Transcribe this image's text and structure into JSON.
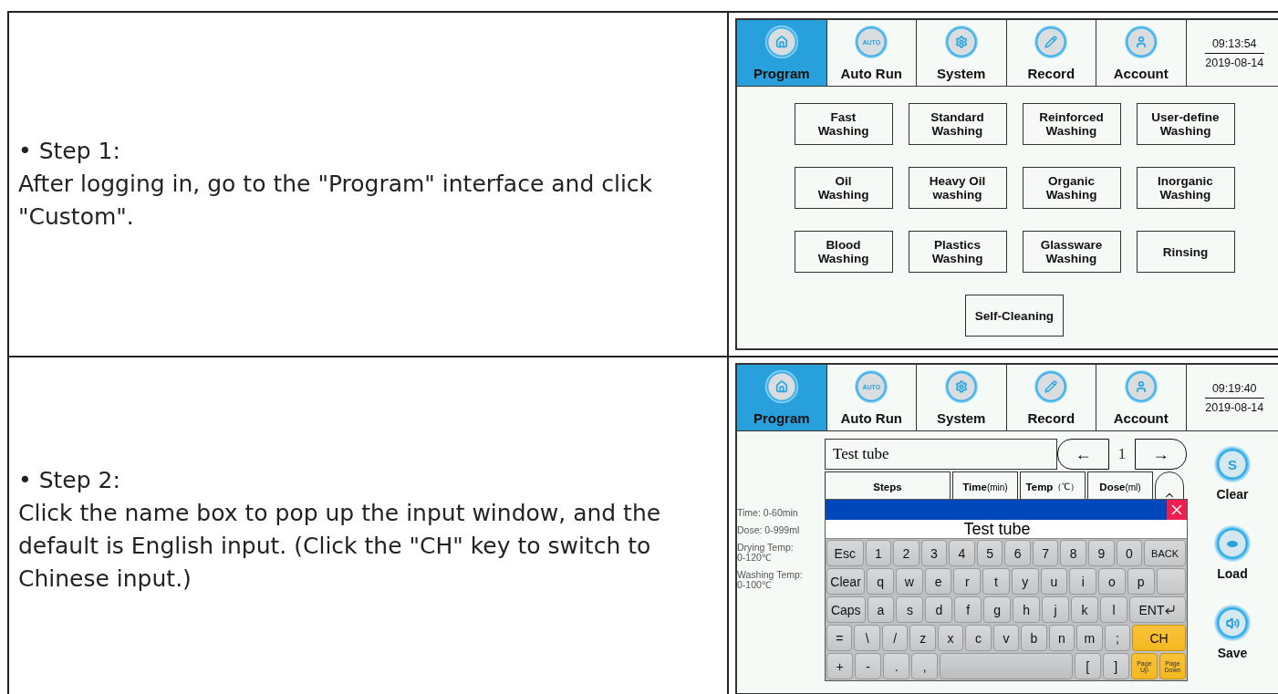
{
  "rows": [
    {
      "step": "• Step 1:",
      "text": "After logging in, go to the \"Program\" interface and click \"Custom\".",
      "screen": {
        "kind": "program",
        "tabs": [
          {
            "label": "Program",
            "kind": "home",
            "selected": true
          },
          {
            "label": "Auto Run",
            "kind": "auto",
            "icon_text": "AUTO",
            "selected": false
          },
          {
            "label": "System",
            "kind": "gear",
            "selected": false
          },
          {
            "label": "Record",
            "kind": "pencil",
            "selected": false
          },
          {
            "label": "Account",
            "kind": "person",
            "selected": false
          }
        ],
        "clock": {
          "time": "09:13:54",
          "date": "2019-08-14"
        },
        "programs": [
          "Fast\nWashing",
          "Standard\nWashing",
          "Reinforced\nWashing",
          "User-define\nWashing",
          "Oil\nWashing",
          "Heavy Oil\nwashing",
          "Organic\nWashing",
          "Inorganic\nWashing",
          "Blood\nWashing",
          "Plastics\nWashing",
          "Glassware\nWashing",
          "Rinsing",
          "Self-Cleaning"
        ]
      }
    },
    {
      "step": "• Step 2:",
      "text": "Click the name box to pop up the input window, and the default is English input. (Click the \"CH\" key to switch to Chinese input.)",
      "screen": {
        "kind": "editor",
        "tabs": [
          {
            "label": "Program",
            "kind": "home",
            "selected": true
          },
          {
            "label": "Auto Run",
            "kind": "auto",
            "icon_text": "AUTO",
            "selected": false
          },
          {
            "label": "System",
            "kind": "gear",
            "selected": false
          },
          {
            "label": "Record",
            "kind": "pencil",
            "selected": false
          },
          {
            "label": "Account",
            "kind": "person",
            "selected": false
          }
        ],
        "clock": {
          "time": "09:19:40",
          "date": "2019-08-14"
        },
        "hints": [
          "Time: 0-60min",
          "Dose: 0-999ml",
          "Drying Temp:\n0-120℃",
          "Washing Temp:\n0-100℃"
        ],
        "name_field": {
          "value": "Test tube"
        },
        "pager": {
          "prev": "←",
          "page": "1",
          "next": "→"
        },
        "columns": [
          {
            "label": "Steps"
          },
          {
            "label": "Time",
            "unit": "(min)"
          },
          {
            "label": "Temp",
            "unit": "（℃）"
          },
          {
            "label": "Dose",
            "unit": "(ml)"
          }
        ],
        "keyboard": {
          "input": "Test tube",
          "rows": [
            [
              {
                "label": "Esc",
                "kind": "wide"
              },
              {
                "label": "1",
                "kind": "key"
              },
              {
                "label": "2",
                "kind": "key"
              },
              {
                "label": "3",
                "kind": "key"
              },
              {
                "label": "4",
                "kind": "key"
              },
              {
                "label": "5",
                "kind": "key"
              },
              {
                "label": "6",
                "kind": "key"
              },
              {
                "label": "7",
                "kind": "key"
              },
              {
                "label": "8",
                "kind": "key"
              },
              {
                "label": "9",
                "kind": "key"
              },
              {
                "label": "0",
                "kind": "key"
              },
              {
                "label": "BACK",
                "kind": "back"
              }
            ],
            [
              {
                "label": "Clear",
                "kind": "wide"
              },
              {
                "label": "q",
                "kind": "key"
              },
              {
                "label": "w",
                "kind": "key"
              },
              {
                "label": "e",
                "kind": "key"
              },
              {
                "label": "r",
                "kind": "key"
              },
              {
                "label": "t",
                "kind": "key"
              },
              {
                "label": "y",
                "kind": "key"
              },
              {
                "label": "u",
                "kind": "key"
              },
              {
                "label": "i",
                "kind": "key"
              },
              {
                "label": "o",
                "kind": "key"
              },
              {
                "label": "p",
                "kind": "key"
              },
              {
                "kind": "enter-top"
              }
            ],
            [
              {
                "label": "Caps",
                "kind": "wide"
              },
              {
                "label": "a",
                "kind": "key"
              },
              {
                "label": "s",
                "kind": "key"
              },
              {
                "label": "d",
                "kind": "key"
              },
              {
                "label": "f",
                "kind": "key"
              },
              {
                "label": "g",
                "kind": "key"
              },
              {
                "label": "h",
                "kind": "key"
              },
              {
                "label": "j",
                "kind": "key"
              },
              {
                "label": "k",
                "kind": "key"
              },
              {
                "label": "l",
                "kind": "key"
              },
              {
                "label": "ENT",
                "kind": "enter"
              }
            ],
            [
              {
                "label": "=",
                "kind": "key"
              },
              {
                "label": "\\",
                "kind": "key"
              },
              {
                "label": "/",
                "kind": "key"
              },
              {
                "label": "z",
                "kind": "key"
              },
              {
                "label": "x",
                "kind": "key"
              },
              {
                "label": "c",
                "kind": "key"
              },
              {
                "label": "v",
                "kind": "key"
              },
              {
                "label": "b",
                "kind": "key"
              },
              {
                "label": "n",
                "kind": "key"
              },
              {
                "label": "m",
                "kind": "key"
              },
              {
                "label": ";",
                "kind": "key"
              },
              {
                "label": "CH",
                "kind": "accent"
              }
            ],
            [
              {
                "label": "+",
                "kind": "key"
              },
              {
                "label": "-",
                "kind": "key"
              },
              {
                "label": ".",
                "kind": "key"
              },
              {
                "label": ",",
                "kind": "key"
              },
              {
                "kind": "space"
              },
              {
                "label": "[",
                "kind": "key"
              },
              {
                "label": "]",
                "kind": "key"
              },
              {
                "label": "Page\nUp",
                "kind": "small-accent"
              },
              {
                "label": "Page\nDown",
                "kind": "small-accent"
              }
            ]
          ]
        },
        "side_buttons": [
          {
            "label": "Clear",
            "kind": "letter",
            "icon_text": "S"
          },
          {
            "label": "Load",
            "kind": "dot"
          },
          {
            "label": "Save",
            "kind": "speaker"
          }
        ]
      }
    }
  ]
}
